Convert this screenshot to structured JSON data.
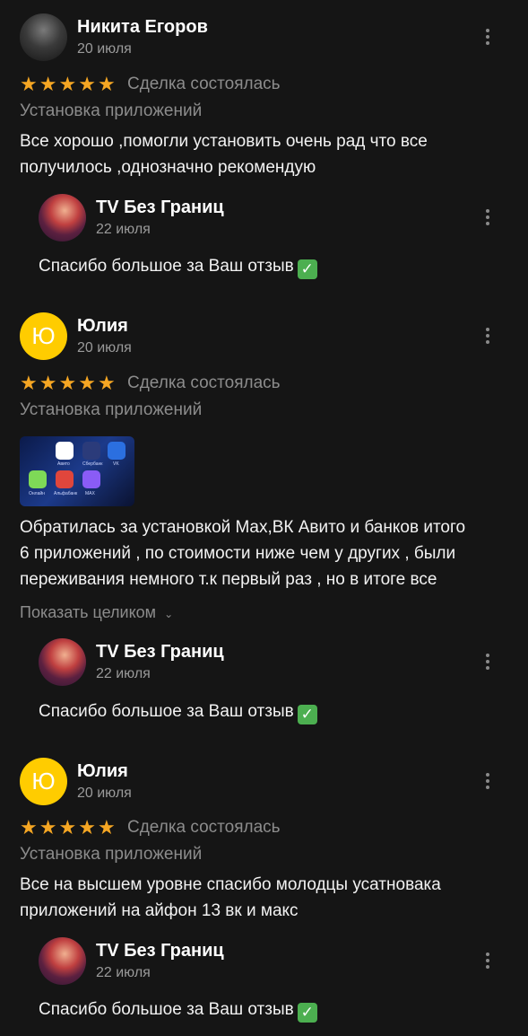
{
  "reviews": [
    {
      "author": "Никита Егоров",
      "date": "20 июля",
      "stars": 5,
      "deal_status": "Сделка состоялась",
      "category": "Установка приложений",
      "text_line1": "Все хорошо ,помогли установить очень рад что все",
      "text_line2": "получилось ,однозначно рекомендую",
      "reply": {
        "author": "TV Без Границ",
        "date": "22 июля",
        "text": "Спасибо большое за Ваш отзыв"
      }
    },
    {
      "author": "Юлия",
      "avatar_letter": "Ю",
      "date": "20 июля",
      "stars": 5,
      "deal_status": "Сделка состоялась",
      "category": "Установка приложений",
      "image_apps": [
        "Авито",
        "Сбербанк",
        "VK",
        "Онлайн",
        "Альфабанк",
        "MAX"
      ],
      "text_line1": "Обратилась за установкой Max,ВК Авито и банков итого",
      "text_line2": "6 приложений , по стоимости ниже чем у других , были",
      "text_line3": "переживания немного т.к первый раз , но в итоге все",
      "show_more": "Показать целиком",
      "reply": {
        "author": "TV Без Границ",
        "date": "22 июля",
        "text": "Спасибо большое за Ваш отзыв"
      }
    },
    {
      "author": "Юлия",
      "avatar_letter": "Ю",
      "date": "20 июля",
      "stars": 5,
      "deal_status": "Сделка состоялась",
      "category": "Установка приложений",
      "text_line1": "Все на высшем уровне спасибо молодцы усатновака",
      "text_line2": "приложений на айфон 13 вк и макс",
      "reply": {
        "author": "TV Без Границ",
        "date": "22 июля",
        "text": "Спасибо большое за Ваш отзыв"
      }
    }
  ],
  "colors": {
    "background": "#151515",
    "star": "#f5a623",
    "avatar_yellow": "#ffcc00",
    "muted_text": "#8c8c8c",
    "check_green": "#4caf50"
  },
  "icons": {
    "more": "more-vertical-icon",
    "star": "star-icon",
    "check": "check-mark-icon",
    "chevron": "chevron-down-icon"
  }
}
